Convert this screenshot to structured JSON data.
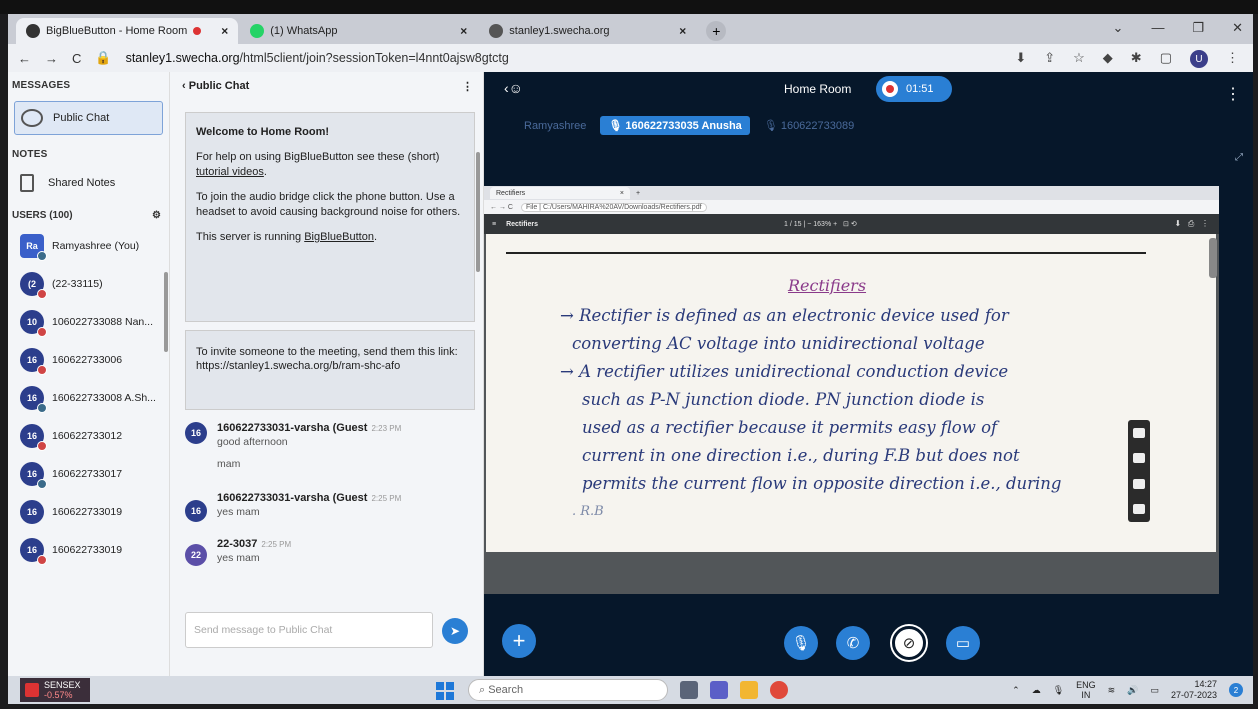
{
  "browser": {
    "tabs": [
      {
        "label": "BigBlueButton - Home Room",
        "color": "#333"
      },
      {
        "label": "(1) WhatsApp",
        "color": "#25d366"
      },
      {
        "label": "stanley1.swecha.org",
        "color": "#555"
      }
    ],
    "url_host": "stanley1.swecha.org",
    "url_path": "/html5client/join?sessionToken=l4nnt0ajsw8gtctg",
    "profile_initial": "U"
  },
  "sidebar": {
    "messages_heading": "MESSAGES",
    "public_chat": "Public Chat",
    "notes_heading": "NOTES",
    "shared_notes": "Shared Notes",
    "users_heading": "USERS (100)",
    "users": [
      {
        "initials": "Ra",
        "name": "Ramyashree (You)",
        "status": "mic"
      },
      {
        "initials": "(2",
        "name": "(22-33115)",
        "status": "red"
      },
      {
        "initials": "10",
        "name": "106022733088 Nan...",
        "status": "red"
      },
      {
        "initials": "16",
        "name": "160622733006",
        "status": "red"
      },
      {
        "initials": "16",
        "name": "160622733008 A.Sh...",
        "status": "mic"
      },
      {
        "initials": "16",
        "name": "160622733012",
        "status": "red"
      },
      {
        "initials": "16",
        "name": "160622733017",
        "status": "mic"
      },
      {
        "initials": "16",
        "name": "160622733019",
        "status": "none"
      },
      {
        "initials": "16",
        "name": "160622733019",
        "status": "red"
      }
    ]
  },
  "chat": {
    "header": "Public Chat",
    "welcome_title": "Welcome to Home Room!",
    "welcome_help_a": "For help on using BigBlueButton see these (short) ",
    "welcome_help_link": "tutorial videos",
    "welcome_help_b": ".",
    "welcome_audio": "To join the audio bridge click the phone button. Use a headset to avoid causing background noise for others.",
    "welcome_server_a": "This server is running ",
    "welcome_server_link": "BigBlueButton",
    "welcome_server_b": ".",
    "invite_text": "To invite someone to the meeting, send them this link:",
    "invite_link": "https://stanley1.swecha.org/b/ram-shc-afo",
    "messages": [
      {
        "avatar": "16",
        "name": "160622733031-varsha (Guest",
        "time": "2:23 PM",
        "lines": [
          "good afternoon",
          "mam"
        ]
      },
      {
        "avatar": "16",
        "name": "160622733031-varsha (Guest",
        "time": "2:25 PM",
        "lines": [
          "yes mam"
        ]
      },
      {
        "avatar": "22",
        "name": "22-3037",
        "time": "2:25 PM",
        "lines": [
          "yes mam"
        ]
      }
    ],
    "input_placeholder": "Send message to Public Chat"
  },
  "presentation": {
    "room_title": "Home Room",
    "recording_time": "01:51",
    "talker_dim_1": "Ramyashree",
    "talker_active": "160622733035 Anusha",
    "talker_dim_2": "160622733089",
    "pdf_tab": "Rectifiers",
    "pdf_url": "File | C:/Users/MAHIRA%20AV/Downloads/Rectifiers.pdf",
    "pdf_title": "Rectifiers",
    "pdf_pages": "1 / 15",
    "pdf_zoom": "163%",
    "notes_title": "Rectifiers",
    "notes_lines": [
      "→ Rectifier is defined as an electronic device used for",
      "converting AC voltage into unidirectional voltage",
      "→ A rectifier utilizes unidirectional conduction device",
      "such as P-N junction diode. PN junction diode is",
      "used as a rectifier because it permits easy flow of",
      "current in one direction i.e., during F.B but does not",
      "permits the current flow in opposite direction i.e., during",
      ". R.B"
    ]
  },
  "taskbar": {
    "ticker_name": "SENSEX",
    "ticker_change": "-0.57%",
    "search_placeholder": "Search",
    "lang_1": "ENG",
    "lang_2": "IN",
    "time": "14:27",
    "date": "27-07-2023",
    "notif_count": "2"
  }
}
